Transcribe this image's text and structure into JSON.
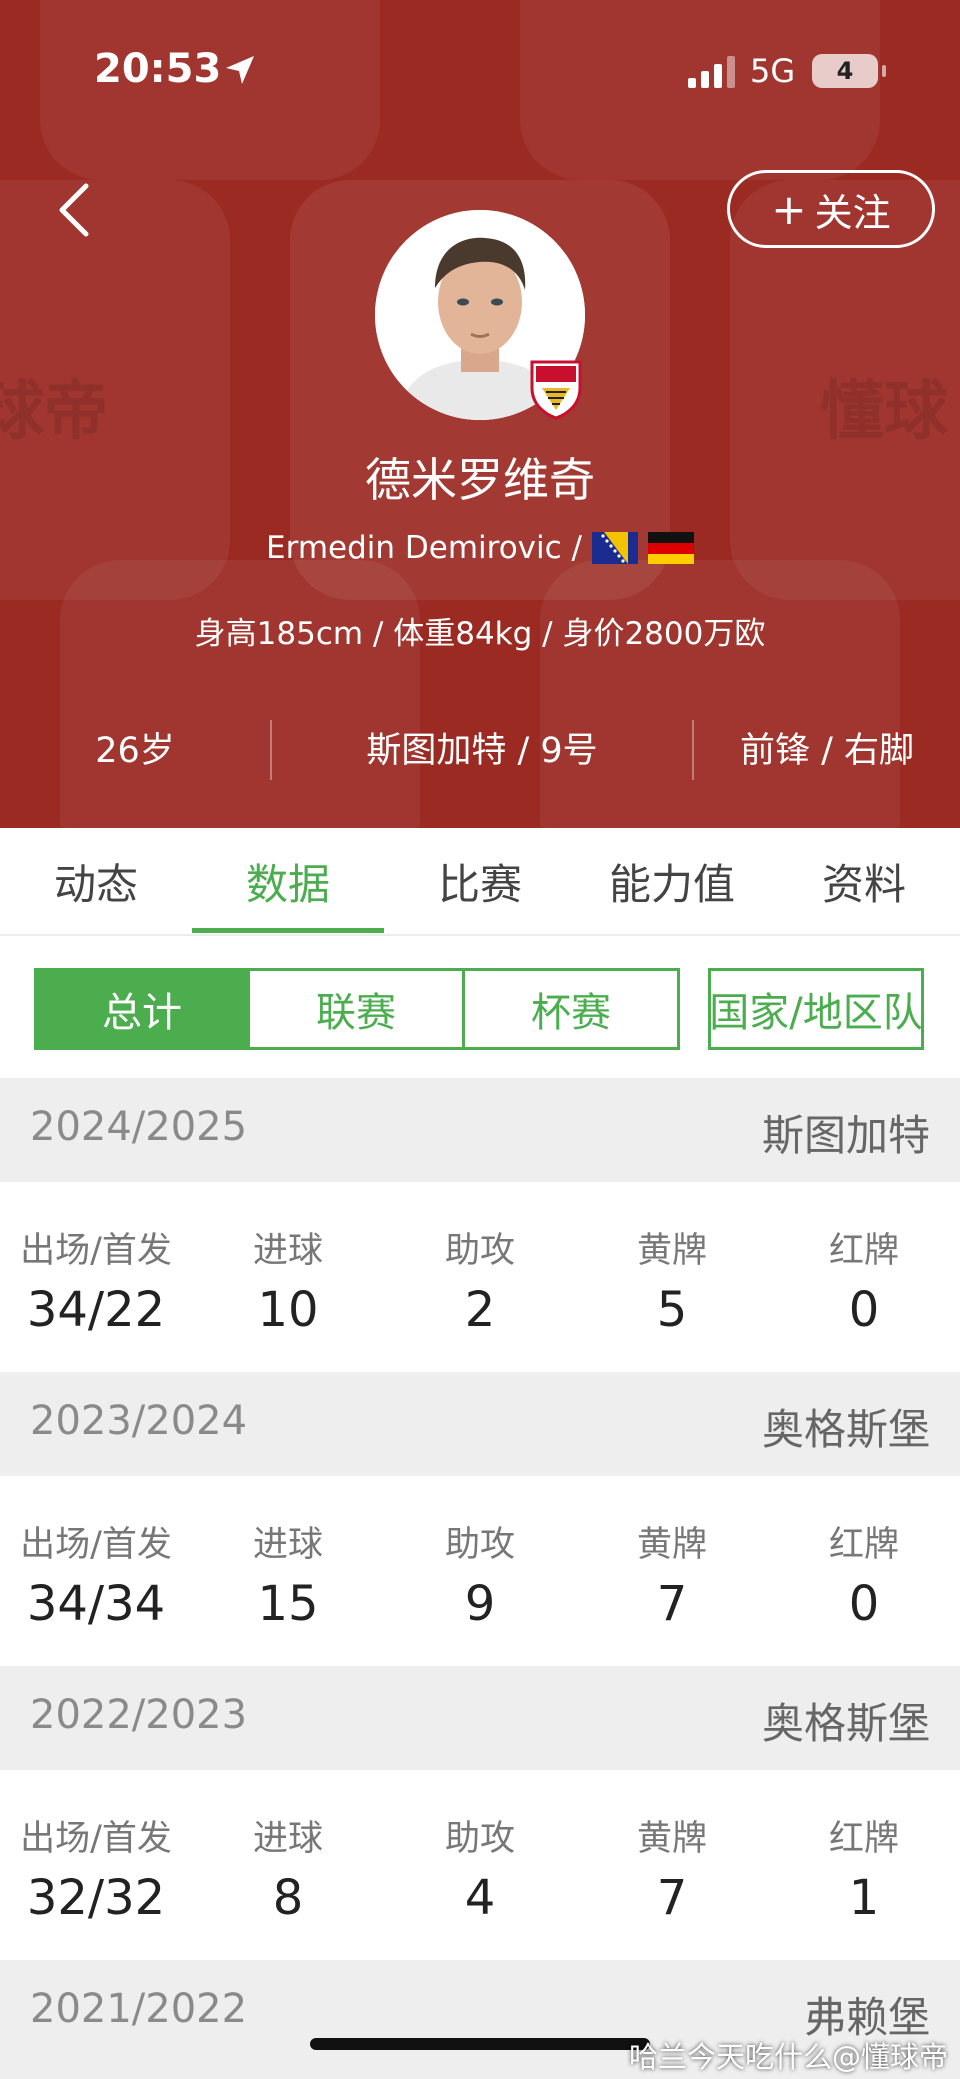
{
  "status_bar": {
    "time": "20:53",
    "network": "5G",
    "battery": "4"
  },
  "header": {
    "follow_label": "关注",
    "name_cn": "德米罗维奇",
    "name_en": "Ermedin Demirovic /",
    "info": "身高185cm / 体重84kg / 身价2800万欧",
    "age": "26岁",
    "club_number": "斯图加特 / 9号",
    "position_foot": "前锋 / 右脚",
    "watermark_left": "球帝",
    "watermark_right": "懂球"
  },
  "tabs": [
    {
      "label": "动态"
    },
    {
      "label": "数据"
    },
    {
      "label": "比赛"
    },
    {
      "label": "能力值"
    },
    {
      "label": "资料"
    }
  ],
  "active_tab": "数据",
  "segments": [
    {
      "label": "总计"
    },
    {
      "label": "联赛"
    },
    {
      "label": "杯赛"
    },
    {
      "label": "国家/地区队"
    }
  ],
  "stat_labels": [
    "出场/首发",
    "进球",
    "助攻",
    "黄牌",
    "红牌"
  ],
  "seasons": [
    {
      "year": "2024/2025",
      "club": "斯图加特",
      "values": [
        "34/22",
        "10",
        "2",
        "5",
        "0"
      ]
    },
    {
      "year": "2023/2024",
      "club": "奥格斯堡",
      "values": [
        "34/34",
        "15",
        "9",
        "7",
        "0"
      ]
    },
    {
      "year": "2022/2023",
      "club": "奥格斯堡",
      "values": [
        "32/32",
        "8",
        "4",
        "7",
        "1"
      ]
    },
    {
      "year": "2021/2022",
      "club": "弗赖堡"
    }
  ],
  "credit": "哈兰今天吃什么@懂球帝",
  "colors": {
    "header_red": "#9b2a22",
    "accent_green": "#4cad4f"
  }
}
